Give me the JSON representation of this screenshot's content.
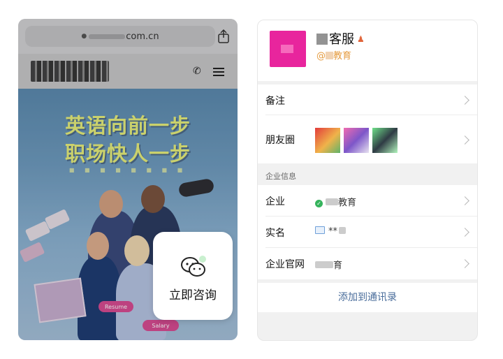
{
  "browser": {
    "url_visible": "com.cn",
    "share_icon": "share-icon"
  },
  "site": {
    "header_icons": [
      "phone-icon",
      "menu-icon"
    ]
  },
  "banner": {
    "title_line1": "英语向前一步",
    "title_line2": "职场快人一步",
    "resume_tag": "Resume",
    "salary_tag": "Salary",
    "text_color": "#e9f07c"
  },
  "consult": {
    "label": "立即咨询",
    "icon": "wechat-icon"
  },
  "contact": {
    "name_suffix": "客服",
    "handle_prefix": "@",
    "handle_suffix": "教育",
    "avatar_color": "#e8259d",
    "rows": {
      "remark": "备注",
      "moments": "朋友圈",
      "company": "企业",
      "company_value": "教育",
      "real_name": "实名",
      "real_name_value": "**",
      "website": "企业官网",
      "website_value": "育"
    },
    "section_title": "企业信息",
    "add_button": "添加到通讯录",
    "link_color": "#4a6d9b"
  }
}
